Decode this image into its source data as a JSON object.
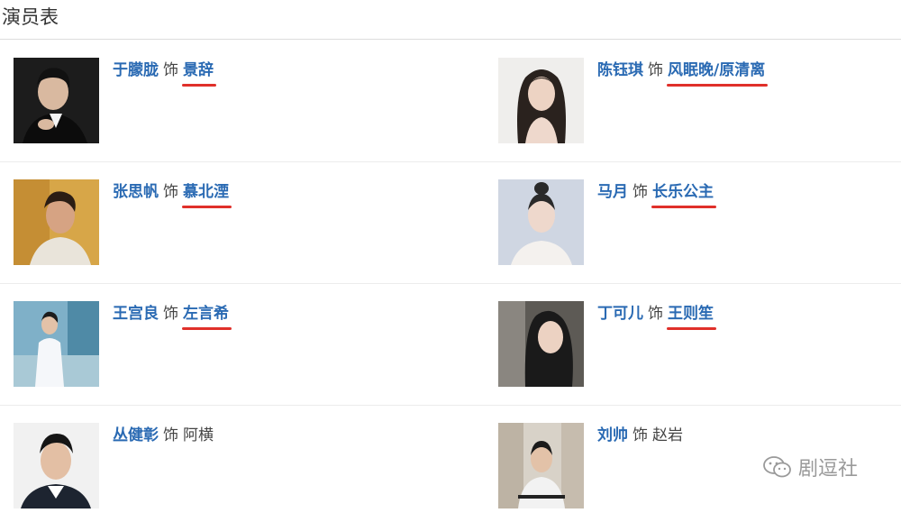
{
  "page": {
    "title": "演员表"
  },
  "separator_text": "饰",
  "cast": [
    {
      "actor": "于朦胧",
      "role": "景辞",
      "underlined": true
    },
    {
      "actor": "陈钰琪",
      "role": "风眠晚/原清离",
      "underlined": true
    },
    {
      "actor": "张思帆",
      "role": "慕北湮",
      "underlined": true
    },
    {
      "actor": "马月",
      "role": "长乐公主",
      "underlined": true
    },
    {
      "actor": "王宫良",
      "role": "左言希",
      "underlined": true
    },
    {
      "actor": "丁可儿",
      "role": "王则笙",
      "underlined": true
    },
    {
      "actor": "丛健彰",
      "role": "阿横",
      "underlined": false
    },
    {
      "actor": "刘帅",
      "role": "赵岩",
      "underlined": false
    }
  ],
  "watermark": {
    "text": "剧逗社",
    "icon": "wechat-icon"
  },
  "colors": {
    "link": "#2a6ab3",
    "underline": "#e0302a",
    "divider": "#ececec"
  }
}
